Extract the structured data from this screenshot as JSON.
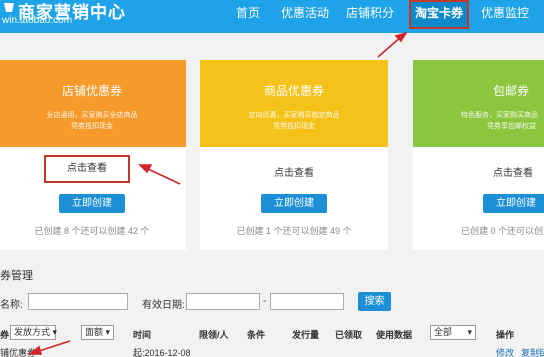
{
  "header": {
    "logo_title": "商家营销中心",
    "logo_url": "win.taobao.com",
    "nav": [
      {
        "label": "首页"
      },
      {
        "label": "优惠活动"
      },
      {
        "label": "店铺积分"
      },
      {
        "label": "淘宝卡券"
      },
      {
        "label": "优惠监控"
      }
    ]
  },
  "cards": [
    {
      "title": "店铺优惠券",
      "desc_line1": "全店通用，买家购买全店商品",
      "desc_line2": "凭券抵扣现金",
      "link": "点击查看",
      "button": "立即创建",
      "status": "已创建 8 个还可以创建 42 个",
      "color": "#f59a2b"
    },
    {
      "title": "商品优惠券",
      "desc_line1": "定向优惠，买家购买指定商品",
      "desc_line2": "凭券抵扣现金",
      "link": "点击查看",
      "button": "立即创建",
      "status": "已创建 1 个还可以创建 49 个",
      "color": "#f5c21a"
    },
    {
      "title": "包邮券",
      "desc_line1": "特色服务，买家购买商品",
      "desc_line2": "凭券享包邮权益",
      "link": "点击查看",
      "button": "立即创建",
      "status": "已创建 0 个还可以创建",
      "color": "#8cc63e"
    }
  ],
  "manage": {
    "title": "券管理",
    "name_label": "名称:",
    "date_label": "有效日期:",
    "dash": "-",
    "search_button": "搜索"
  },
  "table": {
    "col_type_prefix": "券",
    "col_issue_select": "发放方式",
    "col_denom_select": "面额",
    "col_time": "时间",
    "col_limit": "限领/人",
    "col_condition": "条件",
    "col_issued": "发行量",
    "col_received": "已领取",
    "col_used": "使用数据",
    "col_status_select": "全部",
    "col_action": "操作",
    "row1": {
      "name": "铺优惠券",
      "time": "起:2016-12-08",
      "edit": "修改",
      "copy": "复制链"
    }
  }
}
